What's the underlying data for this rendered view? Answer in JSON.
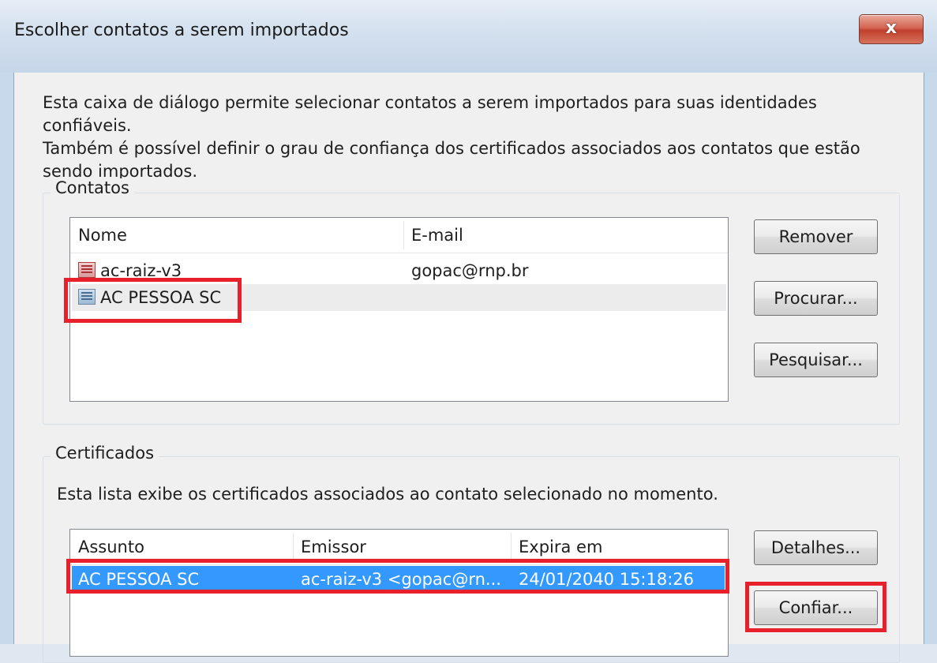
{
  "window": {
    "title": "Escolher contatos a serem importados",
    "close_label": "x"
  },
  "intro": {
    "text": "Esta caixa de diálogo permite selecionar contatos a serem importados para suas identidades confiáveis.\nTambém é possível definir o grau de confiança dos certificados associados aos contatos que estão\nsendo importados."
  },
  "contacts": {
    "group_label": "Contatos",
    "columns": [
      "Nome",
      "E-mail"
    ],
    "rows": [
      {
        "name": "ac-raiz-v3",
        "email": "gopac@rnp.br",
        "icon": "contact-card-icon"
      },
      {
        "name": "AC PESSOA SC",
        "email": "",
        "icon": "contact-card-icon"
      }
    ],
    "buttons": {
      "remove": "Remover",
      "browse": "Procurar...",
      "search": "Pesquisar..."
    }
  },
  "certificates": {
    "group_label": "Certificados",
    "description": "Esta lista exibe os certificados associados ao contato selecionado no momento.",
    "columns": [
      "Assunto",
      "Emissor",
      "Expira em"
    ],
    "rows": [
      {
        "subject": "AC PESSOA SC",
        "issuer": "ac-raiz-v3 <gopac@rn...",
        "expires": "24/01/2040 15:18:26"
      }
    ],
    "buttons": {
      "details": "Detalhes...",
      "trust": "Confiar..."
    }
  },
  "colors": {
    "selection": "#3399ff",
    "highlight": "#e8202c"
  }
}
